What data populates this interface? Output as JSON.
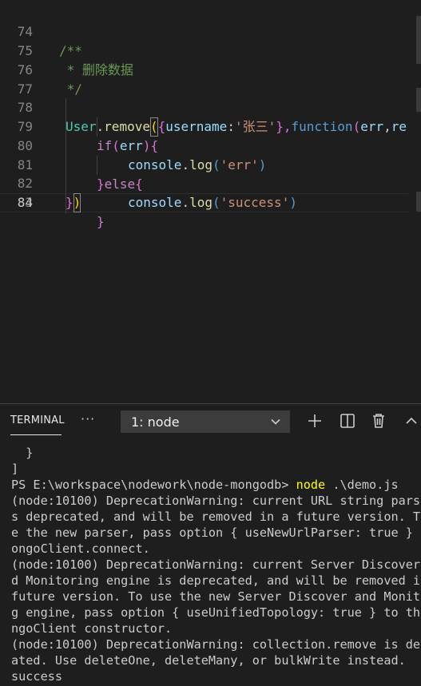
{
  "editor": {
    "lines": [
      {
        "num": "74",
        "comment": "/**"
      },
      {
        "num": "75",
        "comment": " * 删除数据"
      },
      {
        "num": "76",
        "comment": " */"
      },
      {
        "num": "77"
      },
      {
        "num": "78",
        "code": {
          "class": "User",
          "dot": ".",
          "method": "remove",
          "open_paren": "(",
          "open_brace": "{",
          "key": "username",
          "colon": ":",
          "str": "'张三'",
          "close_brace_comma": "},",
          "fn_kw": "function",
          "paren2": "(",
          "param1": "err",
          "comma": ",",
          "param2": "re"
        }
      },
      {
        "num": "79",
        "kw": "if",
        "open": "(",
        "var": "err",
        "close": "){"
      },
      {
        "num": "80",
        "obj": "console",
        "dot": ".",
        "method": "log",
        "open": "(",
        "str": "'err'",
        "close": ")"
      },
      {
        "num": "81",
        "brace_close": "}",
        "kw": "else",
        "brace_open": "{"
      },
      {
        "num": "82",
        "obj": "console",
        "dot": ".",
        "method": "log",
        "open": "(",
        "str": "'success'",
        "close": ")"
      },
      {
        "num": "83",
        "brace": "}"
      },
      {
        "num": "84",
        "brace": "}",
        "paren": ")"
      }
    ]
  },
  "panel": {
    "tab_label": "TERMINAL",
    "more": "···",
    "terminal_select": "1: node"
  },
  "terminal": {
    "lines": [
      "  }",
      "]",
      "PS E:\\workspace\\nodework\\node-mongodb> ",
      "(node:10100) DeprecationWarning: current URL string parse",
      "s deprecated, and will be removed in a future version. To",
      "e the new parser, pass option { useNewUrlParser: true } t",
      "ongoClient.connect.",
      "(node:10100) DeprecationWarning: current Server Discovery",
      "d Monitoring engine is deprecated, and will be removed in",
      "future version. To use the new Server Discover and Monito",
      "g engine, pass option { useUnifiedTopology: true } to the",
      "ngoClient constructor.",
      "(node:10100) DeprecationWarning: collection.remove is dep",
      "ated. Use deleteOne, deleteMany, or bulkWrite instead.",
      "success"
    ],
    "command": "node",
    "command_args": " .\\demo.js"
  },
  "icons": {
    "add": "plus-icon",
    "split": "split-terminal-icon",
    "trash": "trash-icon",
    "maximize": "chevron-up-icon",
    "dropdown": "chevron-down-icon"
  }
}
